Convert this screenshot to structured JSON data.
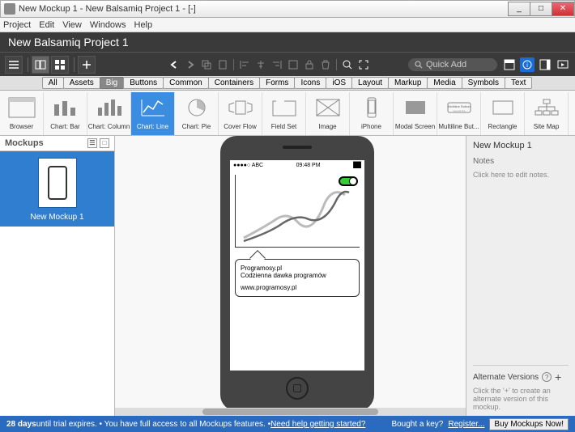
{
  "window": {
    "title": "New Mockup 1 - New Balsamiq Project 1 - [-]"
  },
  "menubar": [
    "Project",
    "Edit",
    "View",
    "Windows",
    "Help"
  ],
  "projectTitle": "New Balsamiq Project 1",
  "quickadd": {
    "placeholder": "Quick Add"
  },
  "categories": [
    "All",
    "Assets",
    "Big",
    "Buttons",
    "Common",
    "Containers",
    "Forms",
    "Icons",
    "iOS",
    "Layout",
    "Markup",
    "Media",
    "Symbols",
    "Text"
  ],
  "activeCategory": "Big",
  "shelfItems": [
    {
      "label": "Browser"
    },
    {
      "label": "Chart: Bar"
    },
    {
      "label": "Chart: Column"
    },
    {
      "label": "Chart: Line"
    },
    {
      "label": "Chart: Pie"
    },
    {
      "label": "Cover Flow"
    },
    {
      "label": "Field Set"
    },
    {
      "label": "Image"
    },
    {
      "label": "iPhone"
    },
    {
      "label": "Modal Screen"
    },
    {
      "label": "Multiline But..."
    },
    {
      "label": "Rectangle"
    },
    {
      "label": "Site Map"
    }
  ],
  "activeShelf": "Chart: Line",
  "sidebar": {
    "title": "Mockups",
    "items": [
      "New Mockup 1"
    ]
  },
  "phone": {
    "status": {
      "left": "●●●●○ ABC",
      "center": "09:48 PM",
      "right": "██"
    },
    "callout": {
      "line1": "Programosy.pl",
      "line2": "Codzienna dawka programów",
      "line3": "www.programosy.pl"
    }
  },
  "rightpanel": {
    "title": "New Mockup 1",
    "notesLabel": "Notes",
    "notesHint": "Click here to edit notes.",
    "altTitle": "Alternate Versions",
    "altHint": "Click the '+' to create an alternate version of this mockup."
  },
  "statusbar": {
    "trial1": "28 days",
    "trial2": " until trial expires.  •  You have full access to all Mockups features.  •  ",
    "helpLink": "Need help getting started?",
    "bought": "Bought a key? ",
    "register": "Register...",
    "buy": "Buy Mockups Now!"
  }
}
